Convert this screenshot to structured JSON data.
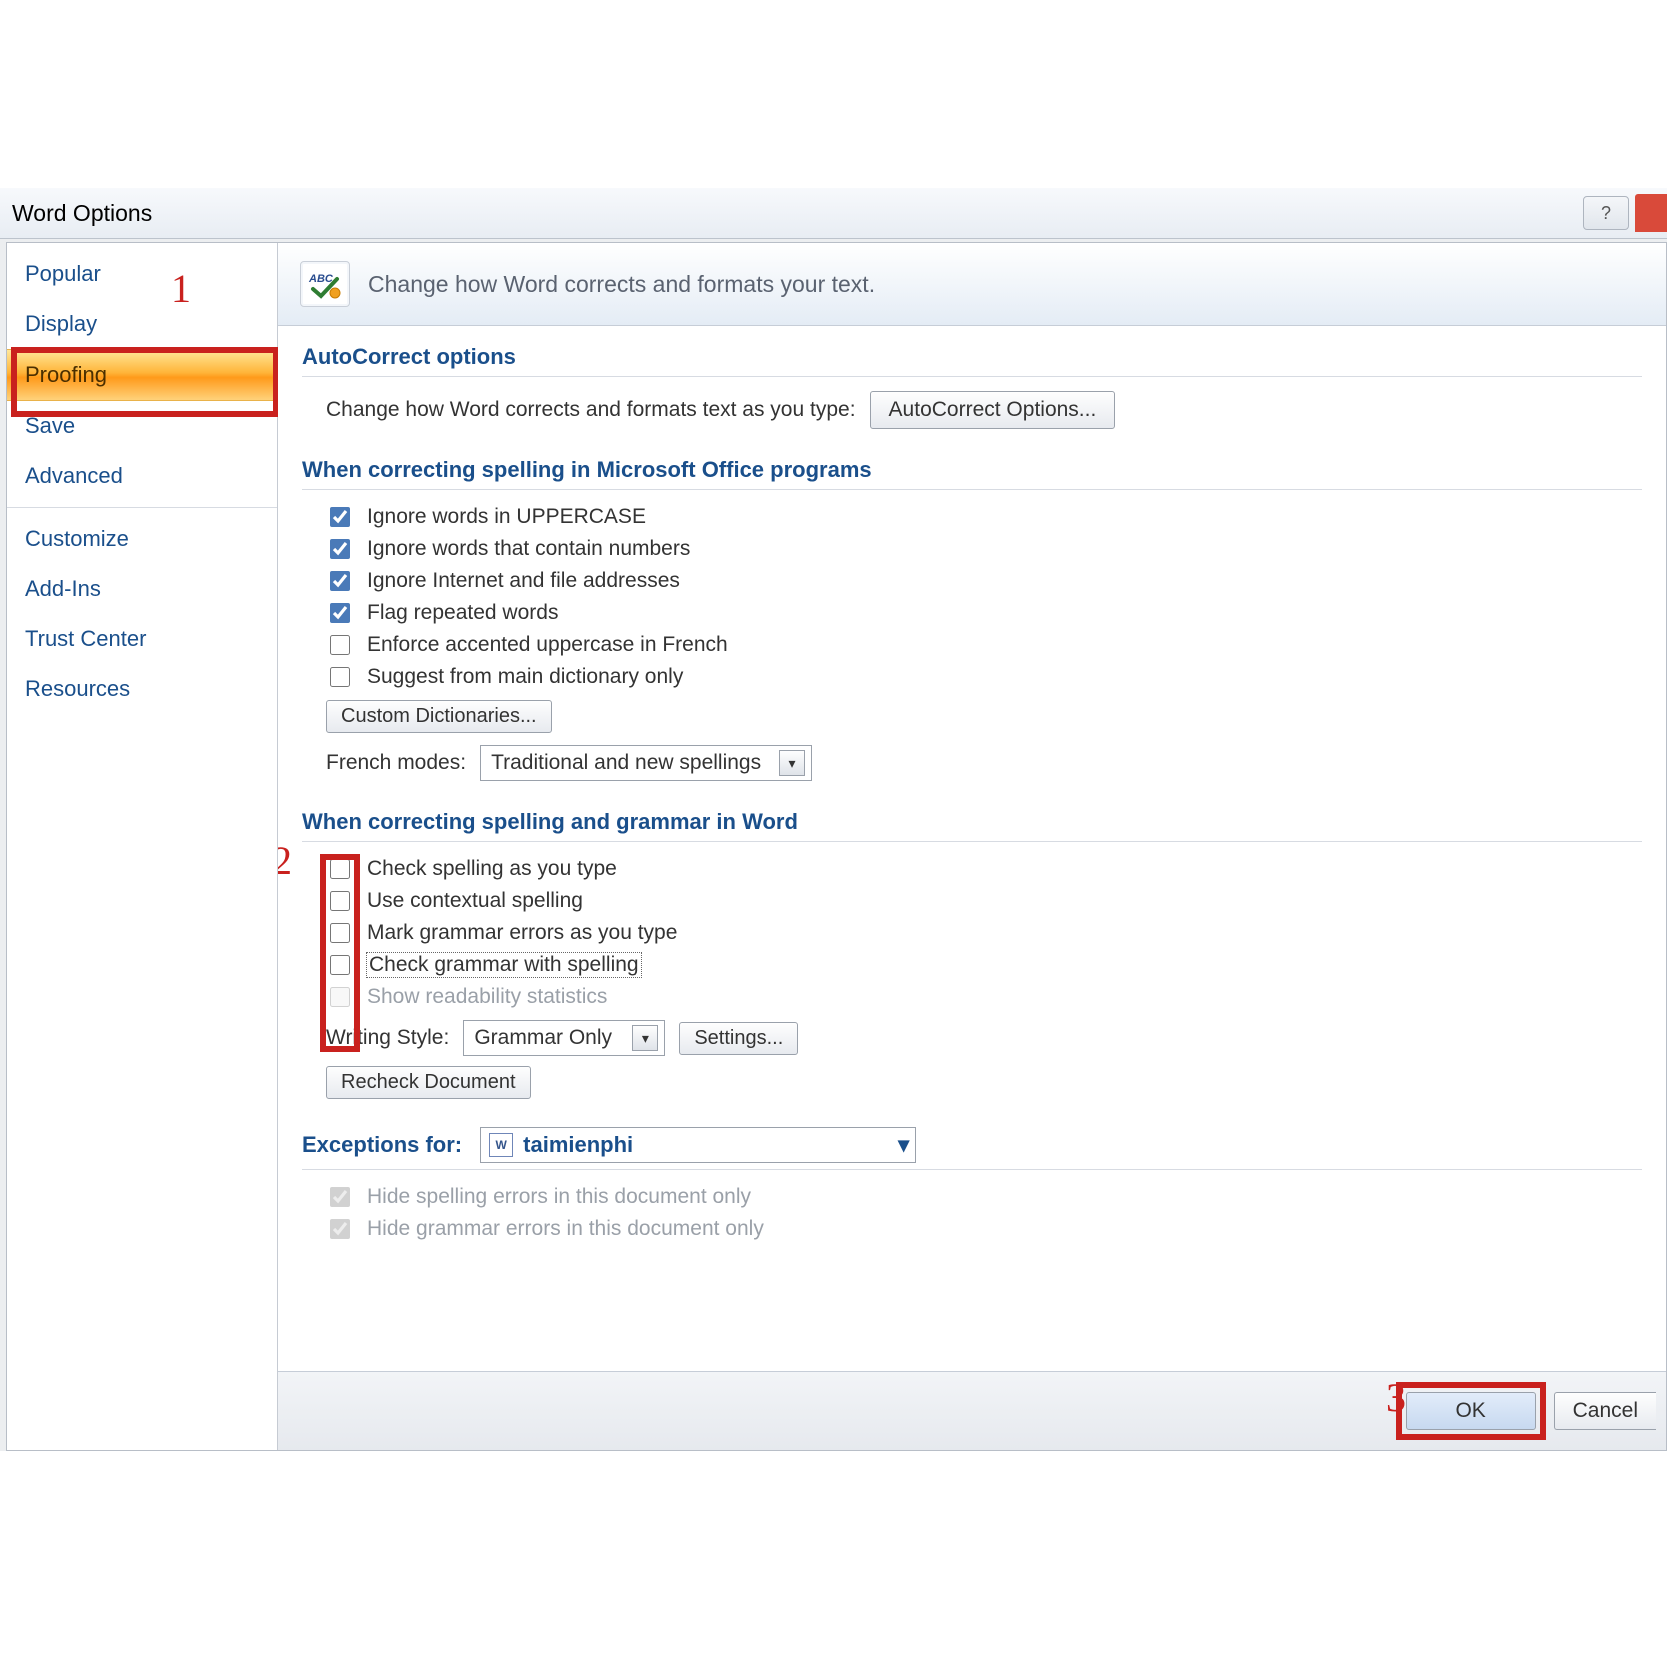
{
  "dialog": {
    "title": "Word Options"
  },
  "header": {
    "heading": "Change how Word corrects and formats your text."
  },
  "sidebar": {
    "items": [
      {
        "label": "Popular"
      },
      {
        "label": "Display"
      },
      {
        "label": "Proofing",
        "active": true
      },
      {
        "label": "Save"
      },
      {
        "label": "Advanced"
      },
      {
        "label": "Customize"
      },
      {
        "label": "Add-Ins"
      },
      {
        "label": "Trust Center"
      },
      {
        "label": "Resources"
      }
    ]
  },
  "autocorrect": {
    "section_title": "AutoCorrect options",
    "desc": "Change how Word corrects and formats text as you type:",
    "button": "AutoCorrect Options..."
  },
  "spelling_office": {
    "section_title": "When correcting spelling in Microsoft Office programs",
    "cb": [
      {
        "label": "Ignore words in UPPERCASE",
        "checked": true
      },
      {
        "label": "Ignore words that contain numbers",
        "checked": true
      },
      {
        "label": "Ignore Internet and file addresses",
        "checked": true
      },
      {
        "label": "Flag repeated words",
        "checked": true
      },
      {
        "label": "Enforce accented uppercase in French",
        "checked": false
      },
      {
        "label": "Suggest from main dictionary only",
        "checked": false
      }
    ],
    "custom_dict_btn": "Custom Dictionaries...",
    "french_modes_label": "French modes:",
    "french_modes_value": "Traditional and new spellings"
  },
  "spelling_word": {
    "section_title": "When correcting spelling and grammar in Word",
    "cb": [
      {
        "label": "Check spelling as you type",
        "checked": false
      },
      {
        "label": "Use contextual spelling",
        "checked": false
      },
      {
        "label": "Mark grammar errors as you type",
        "checked": false
      },
      {
        "label": "Check grammar with spelling",
        "checked": false
      },
      {
        "label": "Show readability statistics",
        "checked": false,
        "disabled": true
      }
    ],
    "writing_style_label": "Writing Style:",
    "writing_style_value": "Grammar Only",
    "settings_btn": "Settings...",
    "recheck_btn": "Recheck Document"
  },
  "exceptions": {
    "label": "Exceptions for:",
    "document": "taimienphi",
    "cb": [
      {
        "label": "Hide spelling errors in this document only",
        "checked": true,
        "disabled": true
      },
      {
        "label": "Hide grammar errors in this document only",
        "checked": true,
        "disabled": true
      }
    ]
  },
  "footer": {
    "ok": "OK",
    "cancel": "Cancel"
  },
  "annotations": {
    "n1": "1",
    "n2": "2",
    "n3": "3"
  },
  "colors": {
    "red": "#c9211e",
    "accent_blue": "#1a4f8b"
  }
}
